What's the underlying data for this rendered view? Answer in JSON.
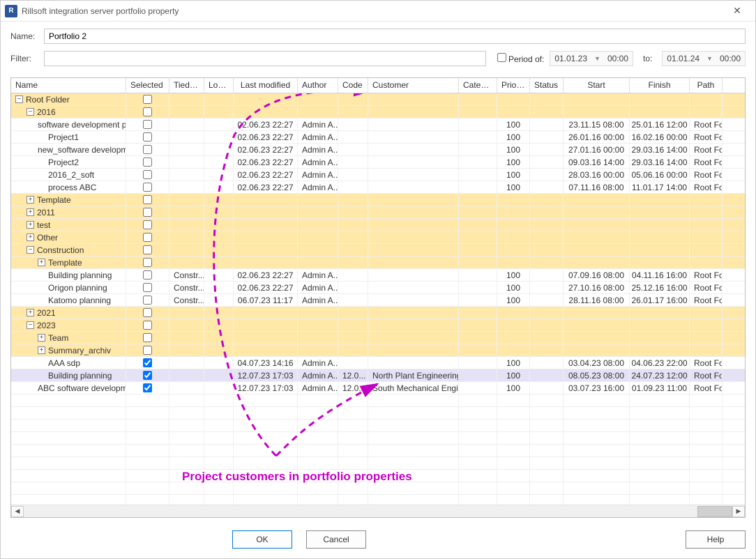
{
  "title": "Rillsoft integration server portfolio property",
  "labels": {
    "name": "Name:",
    "filter": "Filter:",
    "period": "Period of:",
    "to": "to:"
  },
  "name_value": "Portfolio 2",
  "period_from": {
    "date": "01.01.23",
    "time": "00:00"
  },
  "period_to": {
    "date": "01.01.24",
    "time": "00:00"
  },
  "columns": {
    "name": "Name",
    "selected": "Selected",
    "tied": "Tied to...",
    "lock": "Lock...",
    "modified": "Last modified",
    "author": "Author",
    "code": "Code",
    "customer": "Customer",
    "category": "Category",
    "priority": "Priority",
    "status": "Status",
    "start": "Start",
    "finish": "Finish",
    "path": "Path"
  },
  "rows": [
    {
      "type": "folder",
      "depth": 0,
      "toggle": "-",
      "name": "Root Folder",
      "selected": false
    },
    {
      "type": "folder",
      "depth": 1,
      "toggle": "-",
      "name": "2016",
      "selected": false
    },
    {
      "type": "item",
      "depth": 2,
      "name": "software development p",
      "selected": false,
      "modified": "02.06.23 22:27",
      "author": "Admin A...",
      "priority": "100",
      "start": "23.11.15 08:00",
      "finish": "25.01.16 12:00",
      "path": "Root Fold"
    },
    {
      "type": "item",
      "depth": 2,
      "name": "Project1",
      "selected": false,
      "modified": "02.06.23 22:27",
      "author": "Admin A...",
      "priority": "100",
      "start": "26.01.16 00:00",
      "finish": "16.02.16 00:00",
      "path": "Root Fold"
    },
    {
      "type": "item",
      "depth": 2,
      "name": "new_software developm",
      "selected": false,
      "modified": "02.06.23 22:27",
      "author": "Admin A...",
      "priority": "100",
      "start": "27.01.16 00:00",
      "finish": "29.03.16 14:00",
      "path": "Root Fold"
    },
    {
      "type": "item",
      "depth": 2,
      "name": "Project2",
      "selected": false,
      "modified": "02.06.23 22:27",
      "author": "Admin A...",
      "priority": "100",
      "start": "09.03.16 14:00",
      "finish": "29.03.16 14:00",
      "path": "Root Fold"
    },
    {
      "type": "item",
      "depth": 2,
      "name": "2016_2_soft",
      "selected": false,
      "modified": "02.06.23 22:27",
      "author": "Admin A...",
      "priority": "100",
      "start": "28.03.16 00:00",
      "finish": "05.06.16 00:00",
      "path": "Root Fold"
    },
    {
      "type": "item",
      "depth": 2,
      "name": "process ABC",
      "selected": false,
      "modified": "02.06.23 22:27",
      "author": "Admin A...",
      "priority": "100",
      "start": "07.11.16 08:00",
      "finish": "11.01.17 14:00",
      "path": "Root Fold"
    },
    {
      "type": "folder",
      "depth": 1,
      "toggle": "+",
      "name": "Template",
      "selected": false
    },
    {
      "type": "folder",
      "depth": 1,
      "toggle": "+",
      "name": "2011",
      "selected": false
    },
    {
      "type": "folder",
      "depth": 1,
      "toggle": "+",
      "name": "test",
      "selected": false
    },
    {
      "type": "folder",
      "depth": 1,
      "toggle": "+",
      "name": "Other",
      "selected": false
    },
    {
      "type": "folder",
      "depth": 1,
      "toggle": "-",
      "name": "Construction",
      "selected": false
    },
    {
      "type": "folder",
      "depth": 2,
      "toggle": "+",
      "name": "Template",
      "selected": false
    },
    {
      "type": "item",
      "depth": 2,
      "name": "Building planning",
      "selected": false,
      "tied": "Constr...",
      "modified": "02.06.23 22:27",
      "author": "Admin A...",
      "priority": "100",
      "start": "07.09.16 08:00",
      "finish": "04.11.16 16:00",
      "path": "Root Fold"
    },
    {
      "type": "item",
      "depth": 2,
      "name": "Origon planning",
      "selected": false,
      "tied": "Constr...",
      "modified": "02.06.23 22:27",
      "author": "Admin A...",
      "priority": "100",
      "start": "27.10.16 08:00",
      "finish": "25.12.16 16:00",
      "path": "Root Fold"
    },
    {
      "type": "item",
      "depth": 2,
      "name": "Katomo planning",
      "selected": false,
      "tied": "Constr...",
      "modified": "06.07.23 11:17",
      "author": "Admin A...",
      "priority": "100",
      "start": "28.11.16 08:00",
      "finish": "26.01.17 16:00",
      "path": "Root Fold"
    },
    {
      "type": "folder",
      "depth": 1,
      "toggle": "+",
      "name": "2021",
      "selected": false
    },
    {
      "type": "folder",
      "depth": 1,
      "toggle": "-",
      "name": "2023",
      "selected": false
    },
    {
      "type": "folder",
      "depth": 2,
      "toggle": "+",
      "name": "Team",
      "selected": false
    },
    {
      "type": "folder",
      "depth": 2,
      "toggle": "+",
      "name": "Summary_archiv",
      "selected": false
    },
    {
      "type": "item",
      "depth": 2,
      "name": "AAA sdp",
      "selected": true,
      "modified": "04.07.23 14:16",
      "author": "Admin A...",
      "priority": "100",
      "start": "03.04.23 08:00",
      "finish": "04.06.23 22:00",
      "path": "Root Fold"
    },
    {
      "type": "item",
      "depth": 2,
      "name": "Building planning",
      "selected": true,
      "highlight": true,
      "code": "12.0...",
      "modified": "12.07.23 17:03",
      "author": "Admin A...",
      "customer": "North Plant Engineering...",
      "priority": "100",
      "start": "08.05.23 08:00",
      "finish": "24.07.23 12:00",
      "path": "Root Fold"
    },
    {
      "type": "item",
      "depth": 2,
      "name": "ABC software developm",
      "selected": true,
      "code": "12.0...",
      "modified": "12.07.23 17:03",
      "author": "Admin A...",
      "customer": "South Mechanical Engi...",
      "priority": "100",
      "start": "03.07.23 16:00",
      "finish": "01.09.23 11:00",
      "path": "Root Fold"
    }
  ],
  "annotation": "Project customers in portfolio properties",
  "buttons": {
    "ok": "OK",
    "cancel": "Cancel",
    "help": "Help"
  }
}
